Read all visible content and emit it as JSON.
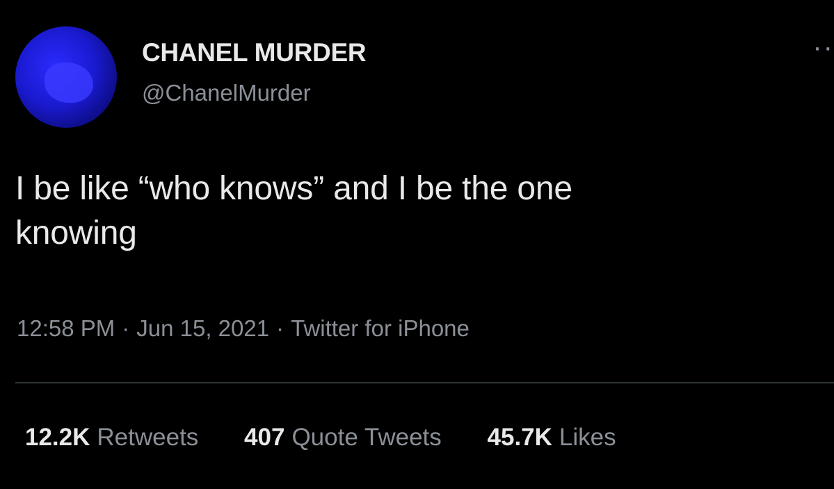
{
  "tweet": {
    "avatar_color": "#1a1ad0",
    "display_name": "CHANEL MURDER",
    "handle": "@ChanelMurder",
    "more_icon": "ellipsis-icon",
    "text_line1": "I be like “who knows” and I be the one",
    "text_line2": "knowing",
    "time": "12:58 PM",
    "separator": "·",
    "date": "Jun 15, 2021",
    "source": "Twitter for iPhone"
  },
  "stats": {
    "retweets_count": "12.2K",
    "retweets_label": "Retweets",
    "quotes_count": "407",
    "quotes_label": "Quote Tweets",
    "likes_count": "45.7K",
    "likes_label": "Likes"
  },
  "colors": {
    "background": "#000000",
    "primary_text": "#e9e9ea",
    "secondary_text": "#8b9097",
    "divider": "#2f3336"
  }
}
